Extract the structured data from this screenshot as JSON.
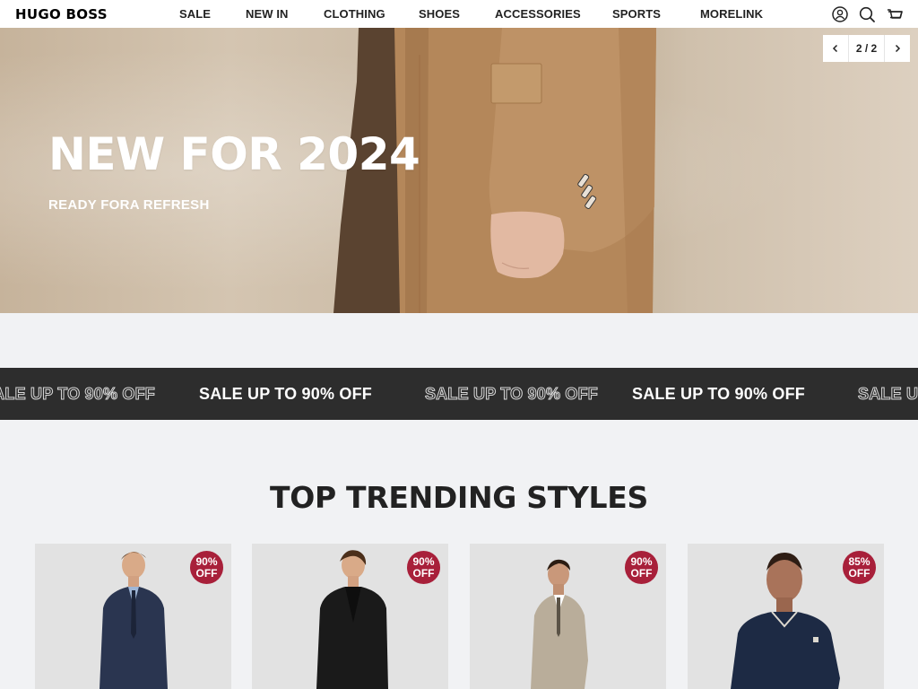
{
  "header": {
    "logo": "HUGO BOSS",
    "nav": [
      "SALE",
      "NEW IN",
      "CLOTHING",
      "SHOES",
      "ACCESSORIES",
      "SPORTS",
      "MORELINK"
    ],
    "icons": [
      "account-icon",
      "search-icon",
      "cart-icon"
    ]
  },
  "hero": {
    "title": "NEW FOR 2024",
    "subtitle": "READY FORA REFRESH",
    "slide_counter": "2 / 2",
    "current_slide": 2,
    "total_slides": 2
  },
  "marquee": {
    "text": "SALE UP TO 90% OFF"
  },
  "trending": {
    "title": "TOP TRENDING STYLES",
    "products": [
      {
        "badge_top": "90%",
        "badge_bottom": "OFF",
        "suit_color": "#2a3550",
        "shirt_color": "#9fb6d6",
        "tie_color": "#1c2438"
      },
      {
        "badge_top": "90%",
        "badge_bottom": "OFF",
        "suit_color": "#1a1a1a",
        "shirt_color": "#0e0e0e",
        "tie_color": "#0b0b0b"
      },
      {
        "badge_top": "90%",
        "badge_bottom": "OFF",
        "suit_color": "#b9ad9a",
        "shirt_color": "#ffffff",
        "tie_color": "#5b5346"
      },
      {
        "badge_top": "85%",
        "badge_bottom": "OFF",
        "suit_color": "#1d2a44",
        "shirt_color": "#1d2a44",
        "tie_color": "#1d2a44"
      }
    ]
  },
  "colors": {
    "badge": "#a8203a",
    "marquee_bg": "#2d2d2d",
    "page_bg": "#f1f2f4"
  }
}
